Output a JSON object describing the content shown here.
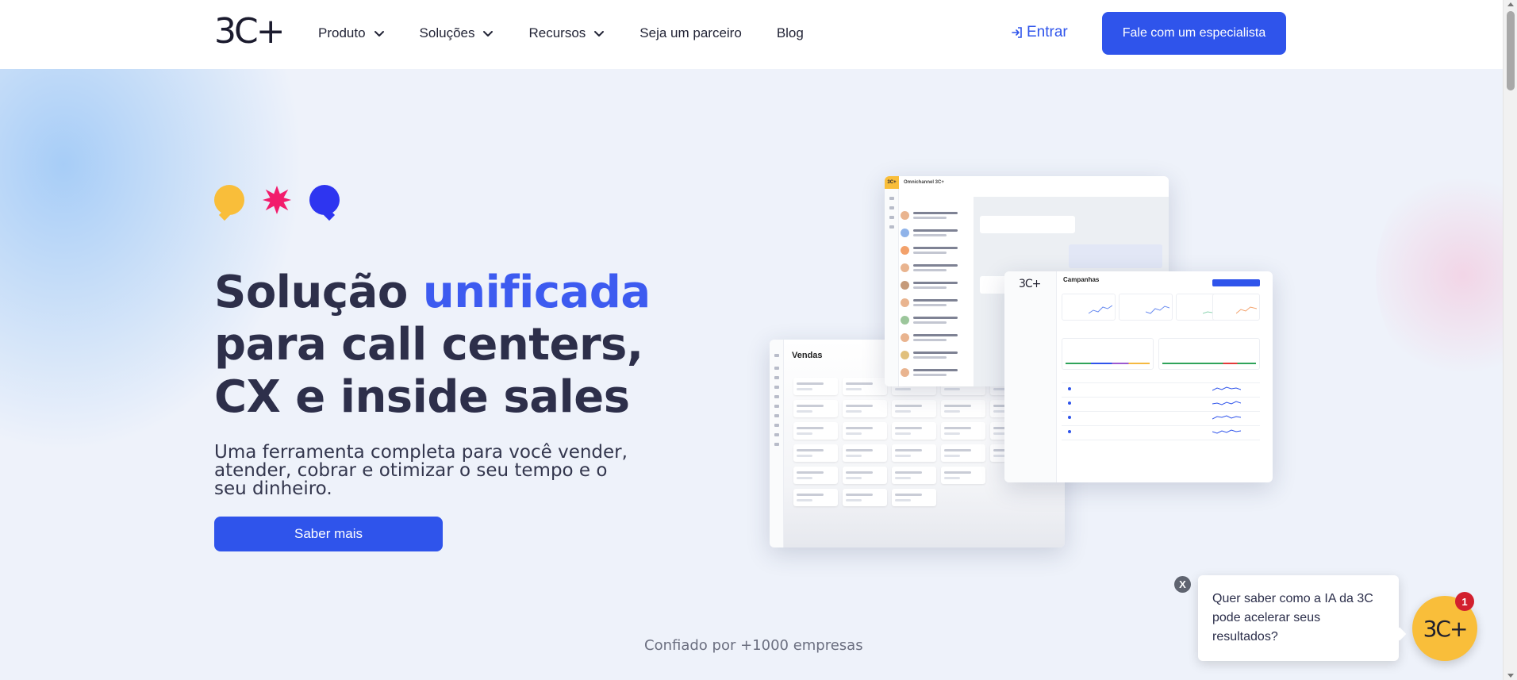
{
  "header": {
    "logo": "3C+",
    "nav": [
      {
        "label": "Produto",
        "has_dropdown": true
      },
      {
        "label": "Soluções",
        "has_dropdown": true
      },
      {
        "label": "Recursos",
        "has_dropdown": true
      },
      {
        "label": "Seja um parceiro",
        "has_dropdown": false
      },
      {
        "label": "Blog",
        "has_dropdown": false
      }
    ],
    "login_label": "Entrar",
    "cta_label": "Fale com um especialista"
  },
  "hero": {
    "headline_part1": "Solução ",
    "headline_accent": "unificada",
    "headline_line2": "para call centers,",
    "headline_line3": "CX e inside sales",
    "subline": "Uma ferramenta completa para você vender, atender, cobrar e otimizar o seu tempo e o seu dinheiro.",
    "cta_label": "Saber mais"
  },
  "mockups": {
    "sales_title": "Vendas",
    "chat_title": "Omnichannel 3C+",
    "campaigns_title": "Campanhas",
    "campaigns_logo": "3C+",
    "chat_logo": "3C+"
  },
  "trust": {
    "text": "Confiado por +1000 empresas"
  },
  "chat_widget": {
    "message": "Quer saber como a IA da 3C pode acelerar seus resultados?",
    "badge_count": "1",
    "logo": "3C+",
    "close_label": "X"
  },
  "colors": {
    "brand_blue": "#2f54eb",
    "accent_blue": "#3d5bf0",
    "yellow": "#f9be3a",
    "pink": "#f21c6c",
    "deep_blue": "#2e35f0",
    "badge_red": "#d2202e"
  }
}
